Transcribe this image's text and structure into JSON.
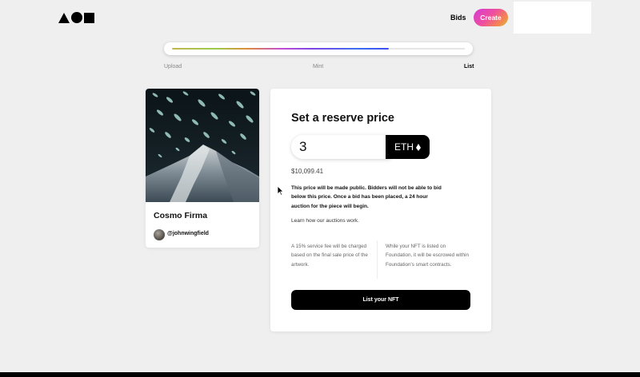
{
  "header": {
    "logo_name": "foundation-logo",
    "nav_bids": "Bids",
    "create_label": "Create"
  },
  "progress": {
    "fraction": 0.74,
    "steps": [
      {
        "label": "Upload",
        "active": false
      },
      {
        "label": "Mint",
        "active": false
      },
      {
        "label": "List",
        "active": true
      }
    ]
  },
  "artwork": {
    "title": "Cosmo Firma",
    "creator_handle": "@johnwingfield"
  },
  "listing": {
    "title": "Set a reserve price",
    "price_value": "3",
    "currency": "ETH",
    "currency_icon": "ethereum-icon",
    "usd_value": "$10,099.41",
    "info": "This price will be made public. Bidders will not be able to bid below this price. Once a bid has been placed, a 24 hour auction for the piece will begin.",
    "learn_link": "Learn how our auctions work.",
    "fee_note": "A 15% service fee will be charged based on the final sale price of the artwork.",
    "escrow_note": "While your NFT is listed on Foundation, it will be escrowed within Foundation's smart contracts.",
    "submit_label": "List your NFT"
  },
  "colors": {
    "accent_gradient_start": "#d43bd3",
    "accent_gradient_end": "#c2c84b",
    "button_black": "#000000",
    "background": "#efefef"
  }
}
